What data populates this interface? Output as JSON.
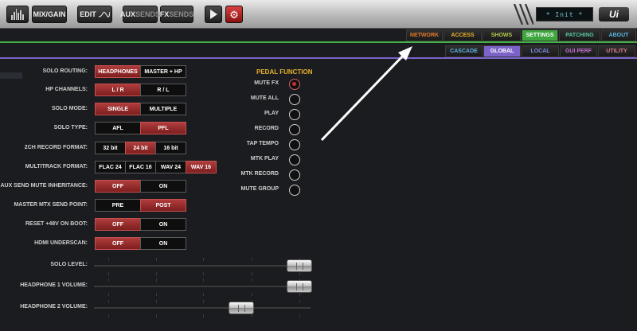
{
  "toolbar": {
    "mix_gain": "MIX/GAIN",
    "edit": "EDIT",
    "aux_prefix": "AUX",
    "aux_suffix": "SENDS",
    "fx_prefix": "FX",
    "fx_suffix": "SENDS",
    "display_text": "* Init *",
    "logo": "Ui"
  },
  "tabs_primary": [
    {
      "label": "NETWORK",
      "color": "#e07a2c",
      "active": false
    },
    {
      "label": "ACCESS",
      "color": "#e8b22c",
      "active": false
    },
    {
      "label": "SHOWS",
      "color": "#b7c94b",
      "active": false
    },
    {
      "label": "SETTINGS",
      "color": "#ffffff",
      "active": true,
      "bg": "#3fa63f"
    },
    {
      "label": "PATCHING",
      "color": "#55c49a",
      "active": false
    },
    {
      "label": "ABOUT",
      "color": "#5ab4e0",
      "active": false
    }
  ],
  "tabs_secondary": [
    {
      "label": "CASCADE",
      "color": "#5ab4e0",
      "active": false
    },
    {
      "label": "GLOBAL",
      "color": "#ffffff",
      "active": true,
      "bg": "#7b63c9"
    },
    {
      "label": "LOCAL",
      "color": "#7b8ce6",
      "active": false
    },
    {
      "label": "GUI PERF",
      "color": "#c36fd0",
      "active": false
    },
    {
      "label": "UTILITY",
      "color": "#e07a8e",
      "active": false
    }
  ],
  "settings": [
    {
      "label": "SOLO ROUTING:",
      "options": [
        "HEADPHONES",
        "MASTER + HP"
      ],
      "selected": 0
    },
    {
      "label": "HP CHANNELS:",
      "options": [
        "L / R",
        "R / L"
      ],
      "selected": 0
    },
    {
      "label": "SOLO MODE:",
      "options": [
        "SINGLE",
        "MULTIPLE"
      ],
      "selected": 0
    },
    {
      "label": "SOLO TYPE:",
      "options": [
        "AFL",
        "PFL"
      ],
      "selected": 1
    },
    {
      "label": "2CH RECORD FORMAT:",
      "options": [
        "32 bit",
        "24 bit",
        "16 bit"
      ],
      "selected": 1
    },
    {
      "label": "MULTITRACK FORMAT:",
      "options": [
        "FLAC 24",
        "FLAC 16",
        "WAV 24",
        "WAV 16"
      ],
      "selected": 3
    },
    {
      "label": "AUX SEND MUTE INHERITANCE:",
      "options": [
        "OFF",
        "ON"
      ],
      "selected": 0
    },
    {
      "label": "MASTER MTX SEND POINT:",
      "options": [
        "PRE",
        "POST"
      ],
      "selected": 1
    },
    {
      "label": "RESET +48V ON BOOT:",
      "options": [
        "OFF",
        "ON"
      ],
      "selected": 0
    },
    {
      "label": "HDMI UNDERSCAN:",
      "options": [
        "OFF",
        "ON"
      ],
      "selected": 0
    }
  ],
  "pedal": {
    "title": "PEDAL FUNCTION",
    "items": [
      {
        "label": "MUTE FX",
        "selected": true
      },
      {
        "label": "MUTE ALL",
        "selected": false
      },
      {
        "label": "PLAY",
        "selected": false
      },
      {
        "label": "RECORD",
        "selected": false
      },
      {
        "label": "TAP TEMPO",
        "selected": false
      },
      {
        "label": "MTK PLAY",
        "selected": false
      },
      {
        "label": "MTK RECORD",
        "selected": false
      },
      {
        "label": "MUTE GROUP",
        "selected": false
      }
    ]
  },
  "sliders": [
    {
      "label": "SOLO LEVEL:",
      "value": 0.95
    },
    {
      "label": "HEADPHONE 1 VOLUME:",
      "value": 0.95
    },
    {
      "label": "HEADPHONE 2 VOLUME:",
      "value": 0.68
    }
  ],
  "colors": {
    "accent_green": "#45b045",
    "accent_purple": "#7b63c9",
    "toggle_on": "#b03c3c",
    "pedal_title": "#e8b22c"
  }
}
